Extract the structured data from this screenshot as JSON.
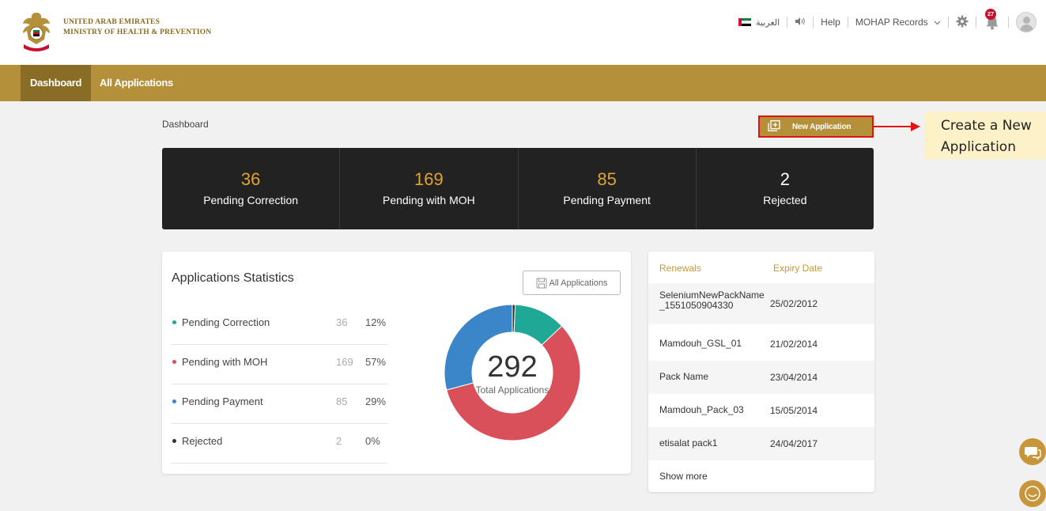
{
  "header": {
    "brand_line1": "UNITED ARAB EMIRATES",
    "brand_line2": "MINISTRY OF HEALTH & PREVENTION",
    "language": "العربية",
    "help": "Help",
    "records_menu": "MOHAP Records",
    "notification_count": "27"
  },
  "nav": {
    "dashboard": "Dashboard",
    "all_applications": "All Applications"
  },
  "breadcrumb": "Dashboard",
  "new_application_button": "New Application",
  "callout": {
    "line1": "Create a New",
    "line2": "Application"
  },
  "stats": [
    {
      "value": "36",
      "label": "Pending Correction"
    },
    {
      "value": "169",
      "label": "Pending with MOH"
    },
    {
      "value": "85",
      "label": "Pending Payment"
    },
    {
      "value": "2",
      "label": "Rejected"
    }
  ],
  "app_stats": {
    "title": "Applications Statistics",
    "all_apps_button": "All Applications",
    "rows": [
      {
        "label": "Pending Correction",
        "count": "36",
        "percent": "12%",
        "color": "#1fa894"
      },
      {
        "label": "Pending with MOH",
        "count": "169",
        "percent": "57%",
        "color": "#d9505a"
      },
      {
        "label": "Pending Payment",
        "count": "85",
        "percent": "29%",
        "color": "#3b86c8"
      },
      {
        "label": "Rejected",
        "count": "2",
        "percent": "0%",
        "color": "#333333"
      }
    ],
    "total": "292",
    "total_caption": "Total Applications"
  },
  "renewals": {
    "col_name": "Renewals",
    "col_expiry": "Expiry Date",
    "rows": [
      {
        "name_line1": "SeleniumNewPackName",
        "name_line2": "_1551050904330",
        "date": "25/02/2012"
      },
      {
        "name": "Mamdouh_GSL_01",
        "date": "21/02/2014"
      },
      {
        "name": "Pack Name",
        "date": "23/04/2014"
      },
      {
        "name": "Mamdouh_Pack_03",
        "date": "15/05/2014"
      },
      {
        "name": "etisalat pack1",
        "date": "24/04/2017"
      }
    ],
    "show_more": "Show more"
  }
}
